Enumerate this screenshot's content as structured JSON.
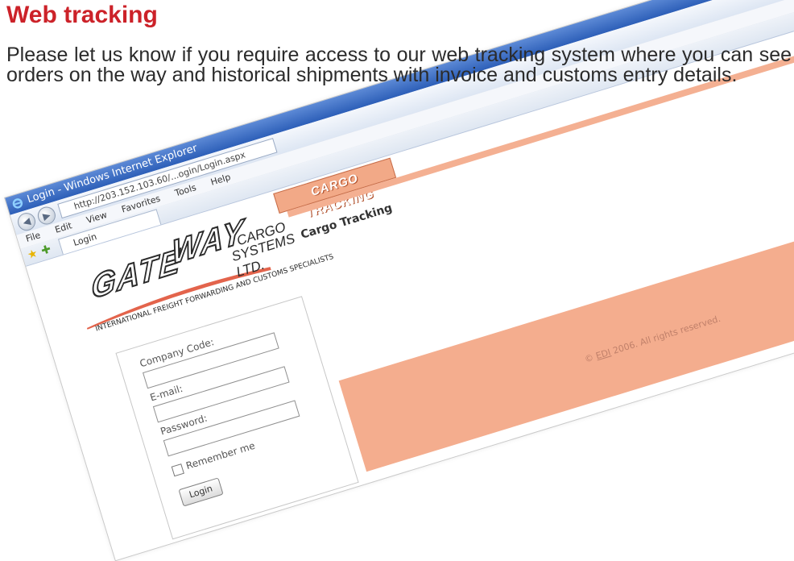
{
  "heading": "Web tracking",
  "intro": "Please let us know if you require access to our web tracking system where you can see orders on the way and historical shipments with invoice and customs entry details.",
  "browser": {
    "title": "Login - Windows Internet Explorer",
    "url": "http://203.152.103.60/...ogin/Login.aspx",
    "menu": [
      "File",
      "Edit",
      "View",
      "Favorites",
      "Tools",
      "Help"
    ],
    "tab_label": "Login"
  },
  "site": {
    "logo_word_1": "GATE",
    "logo_word_2": "WAY",
    "logo_sub_1": "CARGO",
    "logo_sub_2": "SYSTEMS LTD.",
    "logo_tagline": "INTERNATIONAL FREIGHT FORWARDING AND CUSTOMS SPECIALISTS",
    "banner": "CARGO TRACKING",
    "page_heading": "Cargo Tracking",
    "login": {
      "company_code_label": "Company Code:",
      "company_code_value": "",
      "email_label": "E-mail:",
      "email_value": "",
      "password_label": "Password:",
      "password_value": "",
      "remember_label": "Remember me",
      "remember_checked": false,
      "login_button": "Login"
    },
    "copyright_prefix": "© ",
    "copyright_link": "EDI",
    "copyright_suffix": " 2006. All rights reserved."
  },
  "colors": {
    "heading": "#cc2229",
    "accent_orange": "#f4ad8e",
    "ie_blue": "#2d5fb8"
  }
}
